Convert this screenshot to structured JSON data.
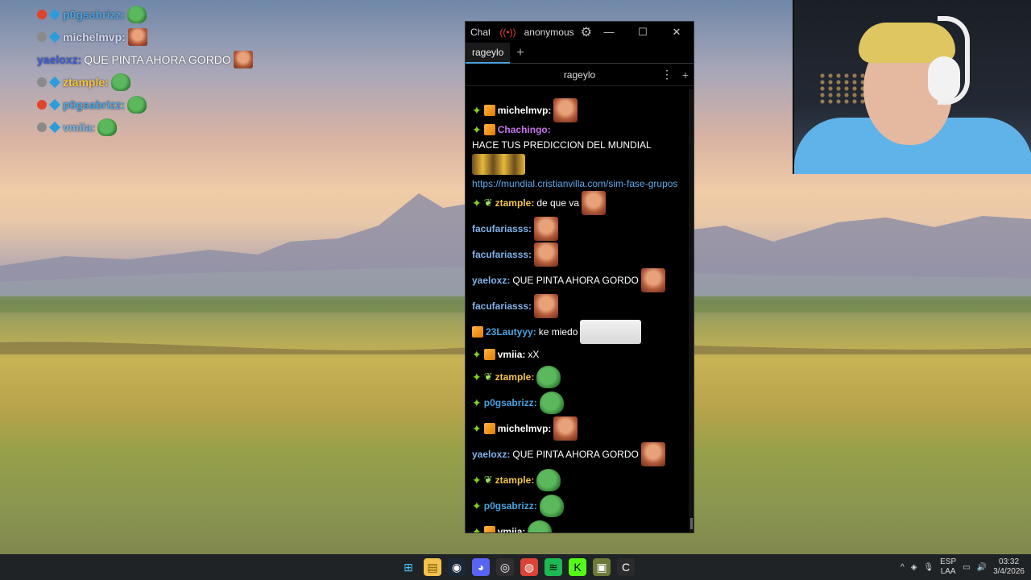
{
  "overlay": {
    "rows": [
      {
        "user": "p0gsabrizz:",
        "color": "#4aa3df",
        "badge": "red",
        "emote": "pepe",
        "msg": ""
      },
      {
        "user": "michelmvp:",
        "color": "#d6d6f5",
        "badge": "gray",
        "emote": "face",
        "msg": ""
      },
      {
        "user": "yaeloxz:",
        "color": "#3b5fd9",
        "badge": "",
        "emote": "face",
        "msg": "QUE PINTA AHORA GORDO"
      },
      {
        "user": "ztample:",
        "color": "#f5c542",
        "badge": "gray",
        "emote": "pepe",
        "msg": ""
      },
      {
        "user": "p0gsabrizz:",
        "color": "#4aa3df",
        "badge": "red",
        "emote": "pepe",
        "msg": ""
      },
      {
        "user": "vmiia:",
        "color": "#6fb3e6",
        "badge": "gray",
        "emote": "pepe",
        "msg": ""
      }
    ]
  },
  "window": {
    "app": "Chatterino",
    "live_icon": "live-icon",
    "user": "anonymous",
    "gear": "⚙",
    "min": "—",
    "max": "☐",
    "close": "✕"
  },
  "tabs": [
    {
      "label": "rageylo"
    }
  ],
  "tab_add": "+",
  "channel": {
    "name": "rageylo",
    "menu": "⋮",
    "add": "+"
  },
  "messages": [
    {
      "badges": [
        "star",
        "box"
      ],
      "user": "michelmvp:",
      "color": "#ffffff",
      "text": "",
      "emote": "face"
    },
    {
      "badges": [
        "star",
        "box"
      ],
      "user": "Chachingo:",
      "color": "#c774e8",
      "text": "HACE TUS PREDICCION DEL MUNDIAL",
      "emote": "minions",
      "link": "https://mundial.cristianvilla.com/sim-fase-grupos"
    },
    {
      "badges": [
        "star",
        "bug"
      ],
      "user": "ztample:",
      "color": "#f5c542",
      "text": "de que va",
      "emote": "face"
    },
    {
      "badges": [],
      "user": "facufariasss:",
      "color": "#7fb2e6",
      "text": "",
      "emote": "face"
    },
    {
      "badges": [],
      "user": "facufariasss:",
      "color": "#7fb2e6",
      "text": "",
      "emote": "face"
    },
    {
      "badges": [],
      "user": "yaeloxz:",
      "color": "#7fb2e6",
      "text": "QUE PINTA AHORA GORDO",
      "emote": "face"
    },
    {
      "badges": [],
      "user": "facufariasss:",
      "color": "#7fb2e6",
      "text": "",
      "emote": "face"
    },
    {
      "badges": [
        "box"
      ],
      "user": "23Lautyyy:",
      "color": "#4aa3df",
      "text": "ke miedo",
      "emote": "dog"
    },
    {
      "badges": [
        "star",
        "box"
      ],
      "user": "vmiia:",
      "color": "#ffffff",
      "text": "xX",
      "emote": ""
    },
    {
      "badges": [
        "star",
        "bug"
      ],
      "user": "ztample:",
      "color": "#f5c542",
      "text": "",
      "emote": "pepe"
    },
    {
      "badges": [
        "star"
      ],
      "user": "p0gsabrizz:",
      "color": "#4aa3df",
      "text": "",
      "emote": "pepe"
    },
    {
      "badges": [
        "star",
        "box"
      ],
      "user": "michelmvp:",
      "color": "#ffffff",
      "text": "",
      "emote": "face"
    },
    {
      "badges": [],
      "user": "yaeloxz:",
      "color": "#7fb2e6",
      "text": "QUE PINTA AHORA GORDO",
      "emote": "face"
    },
    {
      "badges": [
        "star",
        "bug"
      ],
      "user": "ztample:",
      "color": "#f5c542",
      "text": "",
      "emote": "pepe"
    },
    {
      "badges": [
        "star"
      ],
      "user": "p0gsabrizz:",
      "color": "#4aa3df",
      "text": "",
      "emote": "pepe"
    },
    {
      "badges": [
        "star",
        "box"
      ],
      "user": "vmiia:",
      "color": "#ffffff",
      "text": "",
      "emote": "pepe"
    }
  ],
  "taskbar": {
    "apps": [
      {
        "name": "windows-start",
        "bg": "#1f2326",
        "glyph": "⊞",
        "color": "#4cc2ff"
      },
      {
        "name": "file-explorer",
        "bg": "#f2c14e",
        "glyph": "▤",
        "color": "#7a5a00"
      },
      {
        "name": "steam",
        "bg": "#1b2838",
        "glyph": "◉",
        "color": "#ffffff"
      },
      {
        "name": "discord",
        "bg": "#5865f2",
        "glyph": "◕",
        "color": "#ffffff"
      },
      {
        "name": "obs",
        "bg": "#302e31",
        "glyph": "◎",
        "color": "#ffffff"
      },
      {
        "name": "chrome",
        "bg": "#db4437",
        "glyph": "◍",
        "color": "#ffffff"
      },
      {
        "name": "spotify",
        "bg": "#1db954",
        "glyph": "≋",
        "color": "#000000"
      },
      {
        "name": "kick",
        "bg": "#53fc18",
        "glyph": "K",
        "color": "#000000"
      },
      {
        "name": "game",
        "bg": "#6c7a3a",
        "glyph": "▣",
        "color": "#ffffff"
      },
      {
        "name": "chatterino",
        "bg": "#2b2b2b",
        "glyph": "C",
        "color": "#ffffff"
      }
    ],
    "tray_chevron": "^",
    "lang_top": "ESP",
    "lang_bottom": "LAA",
    "time": "03:32",
    "date": "3/4/2026"
  }
}
